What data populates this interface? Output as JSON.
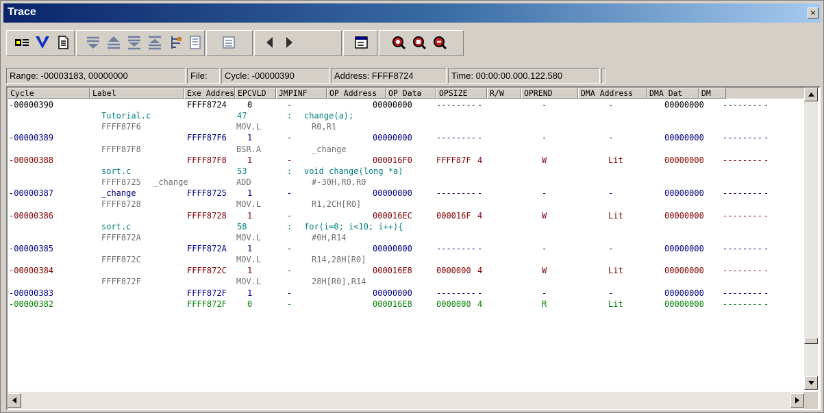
{
  "window": {
    "title": "Trace",
    "close_glyph": "×"
  },
  "toolbar": {
    "buttons": [
      {
        "name": "trace-acquisition-icon"
      },
      {
        "name": "filter-icon"
      },
      {
        "name": "document-icon"
      },
      {
        "name": "find-icon"
      },
      {
        "name": "find-up-icon"
      },
      {
        "name": "find-next-icon"
      },
      {
        "name": "find-previous-icon"
      },
      {
        "name": "source-view-icon"
      },
      {
        "name": "mixed-view-icon"
      },
      {
        "name": "display-mode-icon"
      },
      {
        "name": "previous-icon"
      },
      {
        "name": "next-icon"
      },
      {
        "name": "properties-icon"
      },
      {
        "name": "halt-icon"
      },
      {
        "name": "restart-icon"
      },
      {
        "name": "stop-icon"
      }
    ]
  },
  "info": {
    "range": "Range: -00003183,  00000000",
    "file": "File:",
    "cycle": "Cycle: -00000390",
    "address": "Address: FFFF8724",
    "time": "Time: 00:00:00.000.122.580"
  },
  "columns": [
    "Cycle",
    "Label",
    "Exe Address",
    "EPCVLD",
    "JMPINF",
    "OP Address",
    "OP Data",
    "OPSIZE",
    "R/W",
    "OPREND",
    "DMA Address",
    "DMA Dat",
    "DM"
  ],
  "colors": {
    "black": "#000000",
    "blue": "#000080",
    "red": "#800000",
    "teal": "#008080",
    "gray": "#707070",
    "green": "#008000"
  },
  "rows": [
    {
      "type": "trace",
      "color": "black",
      "cycle": "-00000390",
      "label": "",
      "exe": "FFFF8724",
      "epcvld": "0",
      "jmpinf": "-",
      "opaddr": "00000000",
      "opdata": "--------",
      "opsize": "-",
      "rw": "-",
      "oprend": "-",
      "dmaaddr": "00000000",
      "dmadat": "--------",
      "dm": "-"
    },
    {
      "type": "source",
      "file": "Tutorial.c",
      "line": "47",
      "colon": ":",
      "code": "change(a);"
    },
    {
      "type": "disasm",
      "addr": "FFFF87F6",
      "sym": "",
      "mnem": "MOV.L",
      "operands": "R0,R1"
    },
    {
      "type": "trace",
      "color": "blue",
      "cycle": "-00000389",
      "label": "",
      "exe": "FFFF87F6",
      "epcvld": "1",
      "jmpinf": "-",
      "opaddr": "00000000",
      "opdata": "--------",
      "opsize": "-",
      "rw": "-",
      "oprend": "-",
      "dmaaddr": "00000000",
      "dmadat": "--------",
      "dm": "-"
    },
    {
      "type": "disasm",
      "addr": "FFFF87F8",
      "sym": "",
      "mnem": "BSR.A",
      "operands": "_change"
    },
    {
      "type": "trace",
      "color": "red",
      "cycle": "-00000388",
      "label": "",
      "exe": "FFFF87F8",
      "epcvld": "1",
      "jmpinf": "-",
      "opaddr": "000016F0",
      "opdata": "FFFF87F",
      "opsize": "4",
      "rw": "W",
      "oprend": "Lit",
      "dmaaddr": "00000000",
      "dmadat": "--------",
      "dm": "-"
    },
    {
      "type": "source",
      "file": "sort.c",
      "line": "53",
      "colon": ":",
      "code": "void change(long *a)"
    },
    {
      "type": "disasm",
      "addr": "FFFF8725",
      "sym": "_change",
      "mnem": "ADD",
      "operands": "#-30H,R0,R0"
    },
    {
      "type": "trace",
      "color": "blue",
      "cycle": "-00000387",
      "label": "_change",
      "exe": "FFFF8725",
      "epcvld": "1",
      "jmpinf": "-",
      "opaddr": "00000000",
      "opdata": "--------",
      "opsize": "-",
      "rw": "-",
      "oprend": "-",
      "dmaaddr": "00000000",
      "dmadat": "--------",
      "dm": "-"
    },
    {
      "type": "disasm",
      "addr": "FFFF8728",
      "sym": "",
      "mnem": "MOV.L",
      "operands": "R1,2CH[R0]"
    },
    {
      "type": "trace",
      "color": "red",
      "cycle": "-00000386",
      "label": "",
      "exe": "FFFF8728",
      "epcvld": "1",
      "jmpinf": "-",
      "opaddr": "000016EC",
      "opdata": "000016F",
      "opsize": "4",
      "rw": "W",
      "oprend": "Lit",
      "dmaaddr": "00000000",
      "dmadat": "--------",
      "dm": "-"
    },
    {
      "type": "source",
      "file": "sort.c",
      "line": "58",
      "colon": ":",
      "code": "for(i=0; i<10; i++){"
    },
    {
      "type": "disasm",
      "addr": "FFFF872A",
      "sym": "",
      "mnem": "MOV.L",
      "operands": "#0H,R14"
    },
    {
      "type": "trace",
      "color": "blue",
      "cycle": "-00000385",
      "label": "",
      "exe": "FFFF872A",
      "epcvld": "1",
      "jmpinf": "-",
      "opaddr": "00000000",
      "opdata": "--------",
      "opsize": "-",
      "rw": "-",
      "oprend": "-",
      "dmaaddr": "00000000",
      "dmadat": "--------",
      "dm": "-"
    },
    {
      "type": "disasm",
      "addr": "FFFF872C",
      "sym": "",
      "mnem": "MOV.L",
      "operands": "R14,28H[R0]"
    },
    {
      "type": "trace",
      "color": "red",
      "cycle": "-00000384",
      "label": "",
      "exe": "FFFF872C",
      "epcvld": "1",
      "jmpinf": "-",
      "opaddr": "000016E8",
      "opdata": "0000000",
      "opsize": "4",
      "rw": "W",
      "oprend": "Lit",
      "dmaaddr": "00000000",
      "dmadat": "--------",
      "dm": "-"
    },
    {
      "type": "disasm",
      "addr": "FFFF872F",
      "sym": "",
      "mnem": "MOV.L",
      "operands": "28H[R0],R14"
    },
    {
      "type": "trace",
      "color": "blue",
      "cycle": "-00000383",
      "label": "",
      "exe": "FFFF872F",
      "epcvld": "1",
      "jmpinf": "-",
      "opaddr": "00000000",
      "opdata": "--------",
      "opsize": "-",
      "rw": "-",
      "oprend": "-",
      "dmaaddr": "00000000",
      "dmadat": "--------",
      "dm": "-"
    },
    {
      "type": "trace",
      "color": "green",
      "cycle": "-00000382",
      "label": "",
      "exe": "FFFF872F",
      "epcvld": "0",
      "jmpinf": "-",
      "opaddr": "000016E8",
      "opdata": "0000000",
      "opsize": "4",
      "rw": "R",
      "oprend": "Lit",
      "dmaaddr": "00000000",
      "dmadat": "--------",
      "dm": "-"
    }
  ]
}
